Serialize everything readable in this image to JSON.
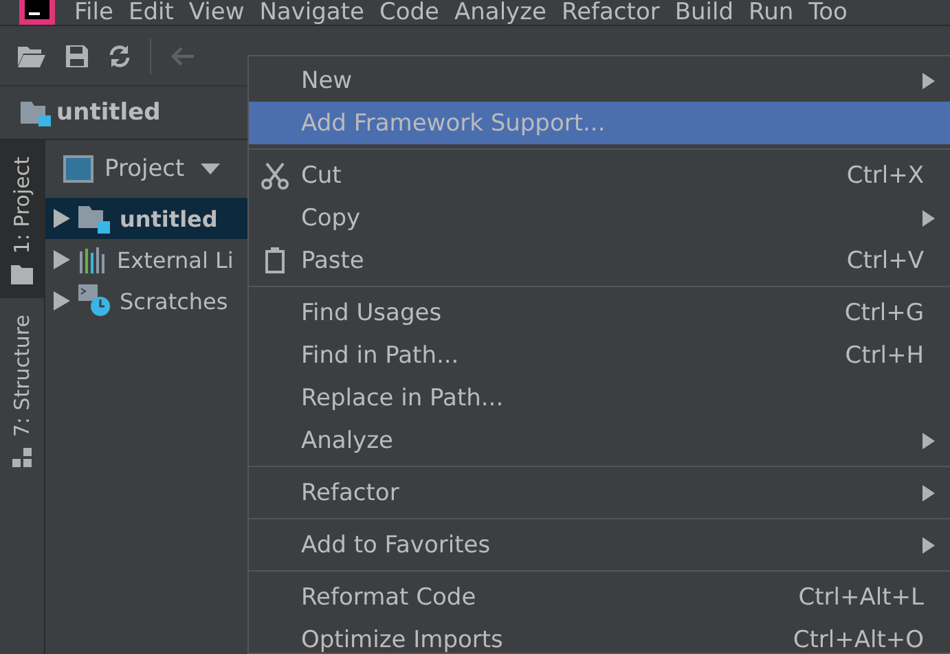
{
  "menu_bar": [
    {
      "label": "File"
    },
    {
      "label": "Edit"
    },
    {
      "label": "View"
    },
    {
      "label": "Navigate"
    },
    {
      "label": "Code"
    },
    {
      "label": "Analyze"
    },
    {
      "label": "Refactor"
    },
    {
      "label": "Build"
    },
    {
      "label": "Run"
    },
    {
      "label": "Too"
    }
  ],
  "navigation_bar": {
    "project": "untitled"
  },
  "side_tabs": [
    {
      "label": "1: Project",
      "selected": true,
      "kind": "folder"
    },
    {
      "label": "7: Structure",
      "selected": false,
      "kind": "structure"
    }
  ],
  "project_panel": {
    "title": "Project",
    "tree": [
      {
        "label": "untitled",
        "selected": true,
        "kind": "module"
      },
      {
        "label": "External Li",
        "selected": false,
        "kind": "libraries"
      },
      {
        "label": "Scratches",
        "selected": false,
        "kind": "scratches"
      }
    ]
  },
  "context_menu": [
    {
      "kind": "item",
      "label": "New",
      "submenu": true,
      "selected": false
    },
    {
      "kind": "item",
      "label": "Add Framework Support...",
      "selected": true
    },
    {
      "kind": "separator"
    },
    {
      "kind": "cut",
      "label": "Cut",
      "shortcut": "Ctrl+X",
      "selected": false
    },
    {
      "kind": "item",
      "label": "Copy",
      "submenu": true,
      "selected": false
    },
    {
      "kind": "paste",
      "label": "Paste",
      "shortcut": "Ctrl+V",
      "selected": false
    },
    {
      "kind": "separator"
    },
    {
      "kind": "item",
      "label": "Find Usages",
      "shortcut": "Ctrl+G",
      "selected": false
    },
    {
      "kind": "item",
      "label": "Find in Path...",
      "shortcut": "Ctrl+H",
      "selected": false
    },
    {
      "kind": "item",
      "label": "Replace in Path...",
      "selected": false
    },
    {
      "kind": "item",
      "label": "Analyze",
      "submenu": true,
      "selected": false
    },
    {
      "kind": "separator"
    },
    {
      "kind": "item",
      "label": "Refactor",
      "submenu": true,
      "selected": false
    },
    {
      "kind": "separator"
    },
    {
      "kind": "item",
      "label": "Add to Favorites",
      "submenu": true,
      "selected": false
    },
    {
      "kind": "separator"
    },
    {
      "kind": "item",
      "label": "Reformat Code",
      "shortcut": "Ctrl+Alt+L",
      "selected": false
    },
    {
      "kind": "item",
      "label": "Optimize Imports",
      "shortcut": "Ctrl+Alt+O",
      "selected": false
    }
  ]
}
